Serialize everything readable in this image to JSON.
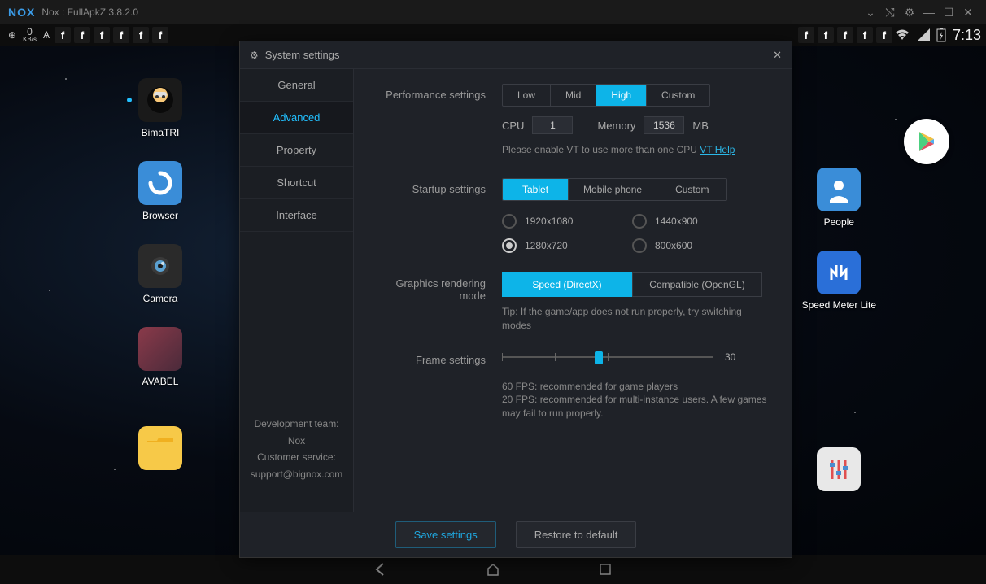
{
  "titlebar": {
    "logo": "NOX",
    "title": "Nox : FullApkZ 3.8.2.0"
  },
  "statusbar": {
    "kbps_top": "0",
    "kbps_bot": "KB/s",
    "clock": "7:13"
  },
  "apps_left": [
    {
      "label": "BimaTRI",
      "color": "#2b2b2b"
    },
    {
      "label": "Browser",
      "color": "#3a8dd8"
    },
    {
      "label": "Camera",
      "color": "#2b2b2b"
    },
    {
      "label": "AVABEL",
      "color": "#6a3a4a"
    }
  ],
  "apps_right": [
    {
      "label": "People",
      "color": "#3a8dd8"
    },
    {
      "label": "Speed Meter Lite",
      "color": "#2a6fd8"
    }
  ],
  "modal": {
    "title": "System settings",
    "tabs": [
      "General",
      "Advanced",
      "Property",
      "Shortcut",
      "Interface"
    ],
    "active_tab": "Advanced",
    "footer_team": "Development team: Nox",
    "footer_service": "Customer service:",
    "footer_email": "support@bignox.com",
    "perf": {
      "label": "Performance settings",
      "options": [
        "Low",
        "Mid",
        "High",
        "Custom"
      ],
      "active": "High",
      "cpu_label": "CPU",
      "cpu_value": "1",
      "mem_label": "Memory",
      "mem_value": "1536",
      "mem_unit": "MB",
      "vt_note": "Please enable VT to use more than one CPU",
      "vt_link": "VT Help"
    },
    "startup": {
      "label": "Startup settings",
      "options": [
        "Tablet",
        "Mobile phone",
        "Custom"
      ],
      "active": "Tablet",
      "resolutions": [
        "1920x1080",
        "1440x900",
        "1280x720",
        "800x600"
      ],
      "selected_res": "1280x720"
    },
    "render": {
      "label": "Graphics rendering mode",
      "speed": "Speed (DirectX)",
      "compat": "Compatible (OpenGL)",
      "tip": "Tip: If the game/app does not run properly, try switching modes"
    },
    "frame": {
      "label": "Frame settings",
      "value": "30",
      "note1": "60 FPS: recommended for game players",
      "note2": "20 FPS: recommended for multi-instance users. A few games may fail to run properly."
    },
    "buttons": {
      "save": "Save settings",
      "restore": "Restore to default"
    }
  }
}
